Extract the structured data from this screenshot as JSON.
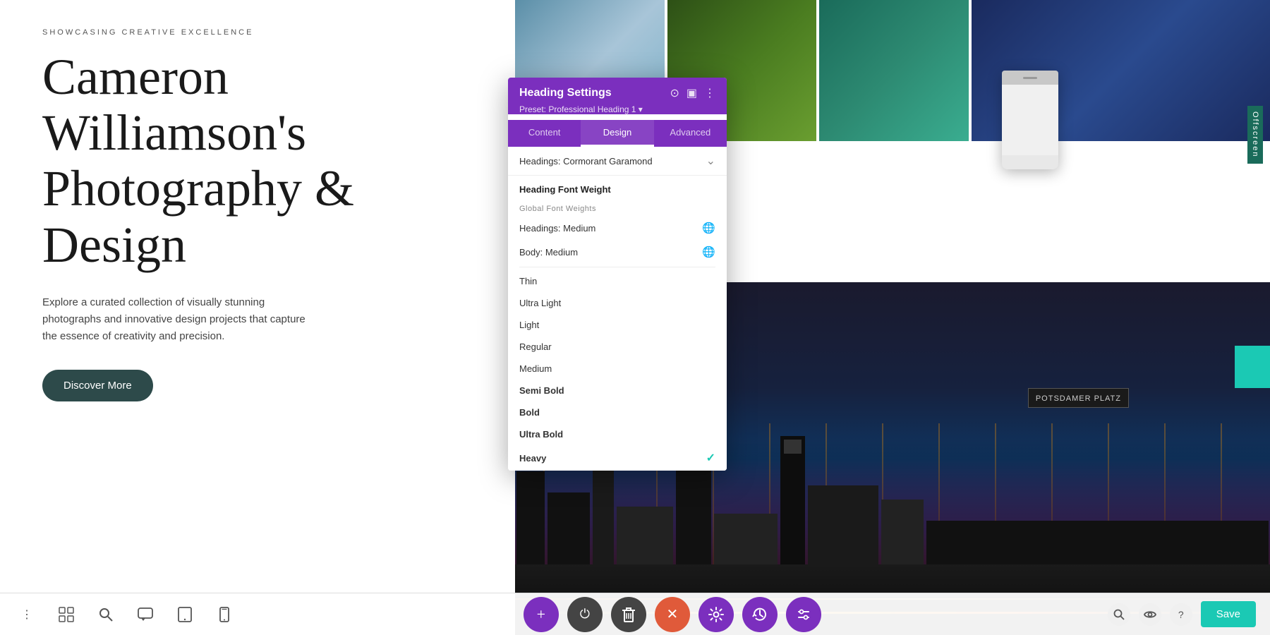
{
  "page": {
    "subtitle": "SHOWCASING CREATIVE EXCELLENCE",
    "heading": "Cameron Williamson's Photography & Design",
    "description": "Explore a curated collection of visually stunning photographs and innovative design projects that capture the essence of creativity and precision.",
    "cta_button": "Discover More",
    "offscreen_label": "Offscreen"
  },
  "panel": {
    "title": "Heading Settings",
    "preset": "Preset: Professional Heading 1 ▾",
    "tabs": [
      {
        "id": "content",
        "label": "Content"
      },
      {
        "id": "design",
        "label": "Design"
      },
      {
        "id": "advanced",
        "label": "Advanced"
      }
    ],
    "active_tab": "design",
    "font_family": "Headings: Cormorant Garamond",
    "section_title": "Heading Font Weight",
    "global_label": "Global Font Weights",
    "font_weights": [
      {
        "id": "headings-medium",
        "label": "Headings: Medium",
        "has_globe": true
      },
      {
        "id": "body-medium",
        "label": "Body: Medium",
        "has_globe": true
      }
    ],
    "weight_options": [
      {
        "id": "thin",
        "label": "Thin",
        "selected": false
      },
      {
        "id": "ultra-light",
        "label": "Ultra Light",
        "selected": false
      },
      {
        "id": "light",
        "label": "Light",
        "selected": false
      },
      {
        "id": "regular",
        "label": "Regular",
        "selected": false
      },
      {
        "id": "medium",
        "label": "Medium",
        "selected": false
      },
      {
        "id": "semi-bold",
        "label": "Semi Bold",
        "selected": false
      },
      {
        "id": "bold",
        "label": "Bold",
        "selected": false
      },
      {
        "id": "ultra-bold",
        "label": "Ultra Bold",
        "selected": false
      },
      {
        "id": "heavy",
        "label": "Heavy",
        "selected": true
      }
    ]
  },
  "toolbar": {
    "dots_icon": "⋮",
    "grid_icon": "⊞",
    "search_icon": "🔍",
    "comment_icon": "💬",
    "tablet_icon": "⬜",
    "phone_icon": "📱",
    "add_label": "+",
    "power_label": "⏻",
    "delete_label": "🗑",
    "close_label": "✕",
    "settings_label": "⚙",
    "history_label": "⟳",
    "adjust_label": "⚲",
    "search_right": "🔍",
    "eye_icon": "👁",
    "help_icon": "?",
    "save_label": "Save"
  },
  "colors": {
    "purple": "#7b2fbe",
    "teal": "#1bc9b4",
    "red_accent": "#e05a3a",
    "dark_bg": "#2d4a4a"
  },
  "preview": {
    "text": "Cameron Williamso..."
  }
}
